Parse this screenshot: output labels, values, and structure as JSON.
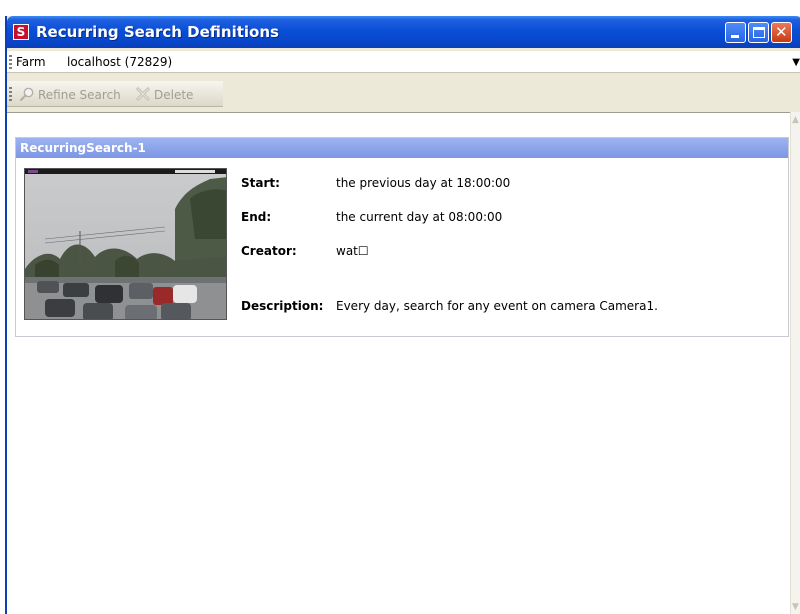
{
  "window": {
    "title": "Recurring Search Definitions",
    "app_icon_letter": "S",
    "controls": [
      "minimize",
      "maximize",
      "close"
    ]
  },
  "farm": {
    "label": "Farm",
    "value": "localhost (72829)"
  },
  "toolbar": {
    "refine_label": "Refine Search",
    "delete_label": "Delete",
    "refine_icon": "magnifier-icon",
    "delete_icon": "delete-x-icon"
  },
  "search": {
    "name": "RecurringSearch-1",
    "start_label": "Start:",
    "start_value": "the previous day at 18:00:00",
    "end_label": "End:",
    "end_value": "the current day at 08:00:00",
    "creator_label": "Creator:",
    "creator_value": "wat☐",
    "description_label": "Description:",
    "description_value": "Every day, search for any event on camera Camera1."
  },
  "colors": {
    "titlebar": "#0a4fd8",
    "card_header": "#8aa3ea",
    "close_button": "#d04a1f"
  }
}
